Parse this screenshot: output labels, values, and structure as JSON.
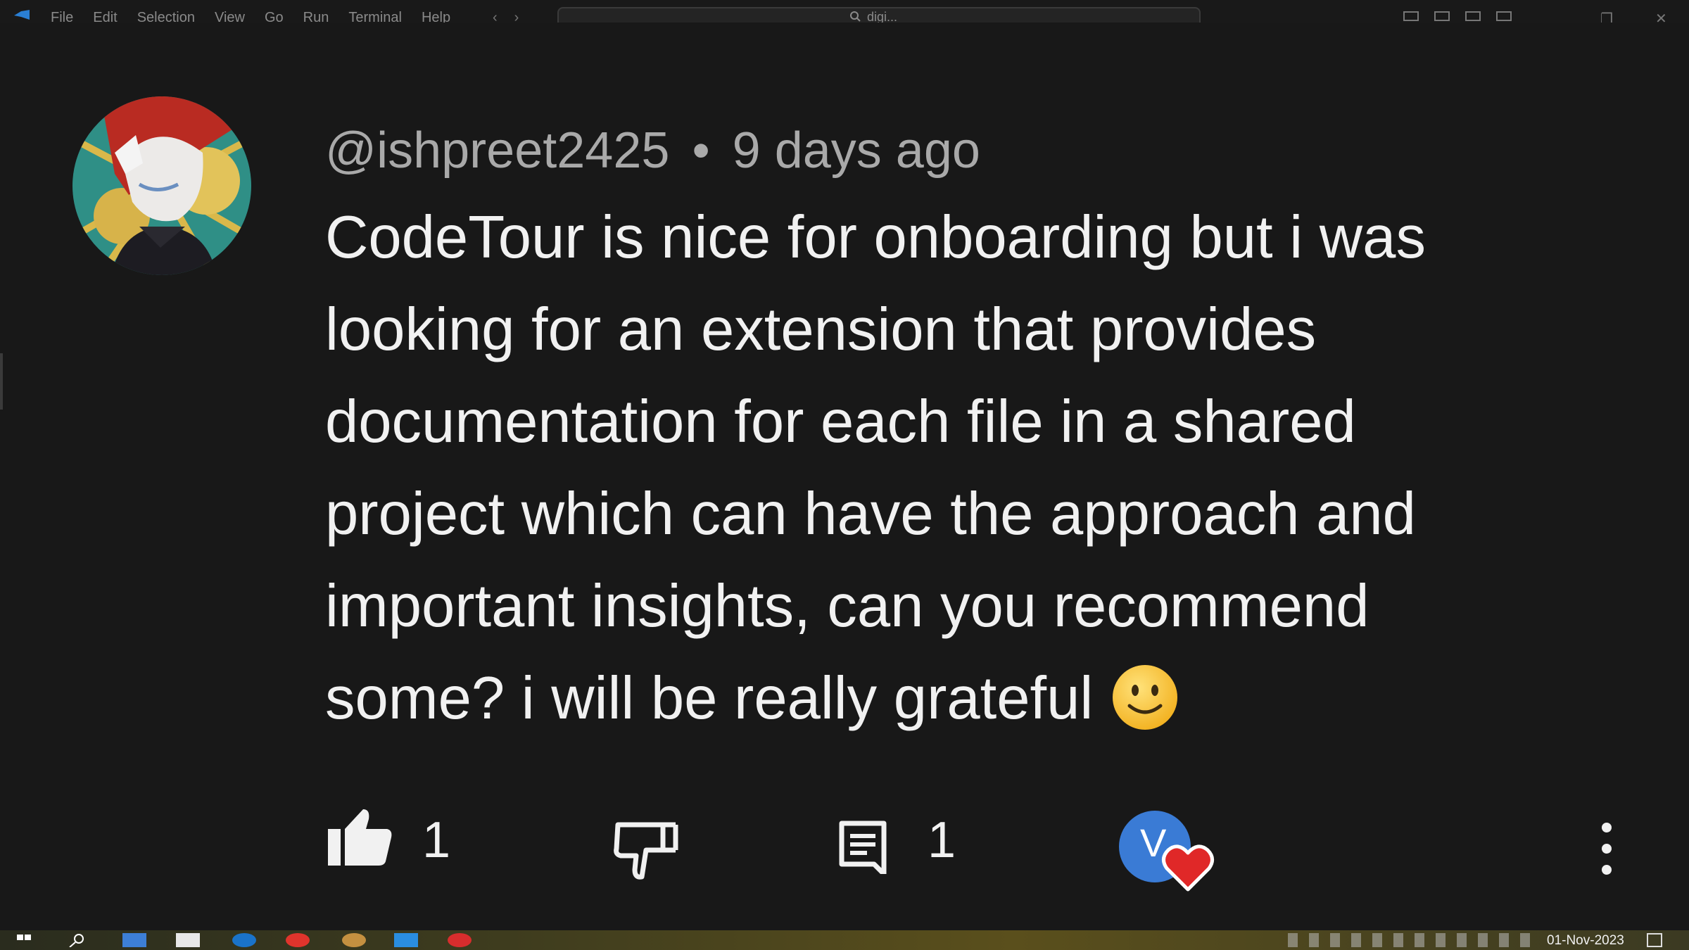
{
  "topbar": {
    "menu": [
      "File",
      "Edit",
      "Selection",
      "View",
      "Go",
      "Run",
      "Terminal",
      "Help"
    ],
    "search_text": "digi..."
  },
  "comment": {
    "author": "@ishpreet2425",
    "separator": "•",
    "time": "9 days ago",
    "lines": [
      "CodeTour is nice for onboarding but i was",
      "looking for an extension that provides",
      "documentation for each file in a shared",
      "project which can have the approach and",
      "important insights, can you recommend",
      "some? i will be really grateful"
    ],
    "emoji": "slightly-smiling-face",
    "likes": "1",
    "replies": "1",
    "creator_heart_initial": "V"
  },
  "taskbar": {
    "date": "01-Nov-2023"
  },
  "colors": {
    "background": "#181818",
    "meta_text": "#a9a9a9",
    "body_text": "#f1f1f1",
    "heart": "#e02828",
    "creator_avatar": "#3a7bd5"
  }
}
